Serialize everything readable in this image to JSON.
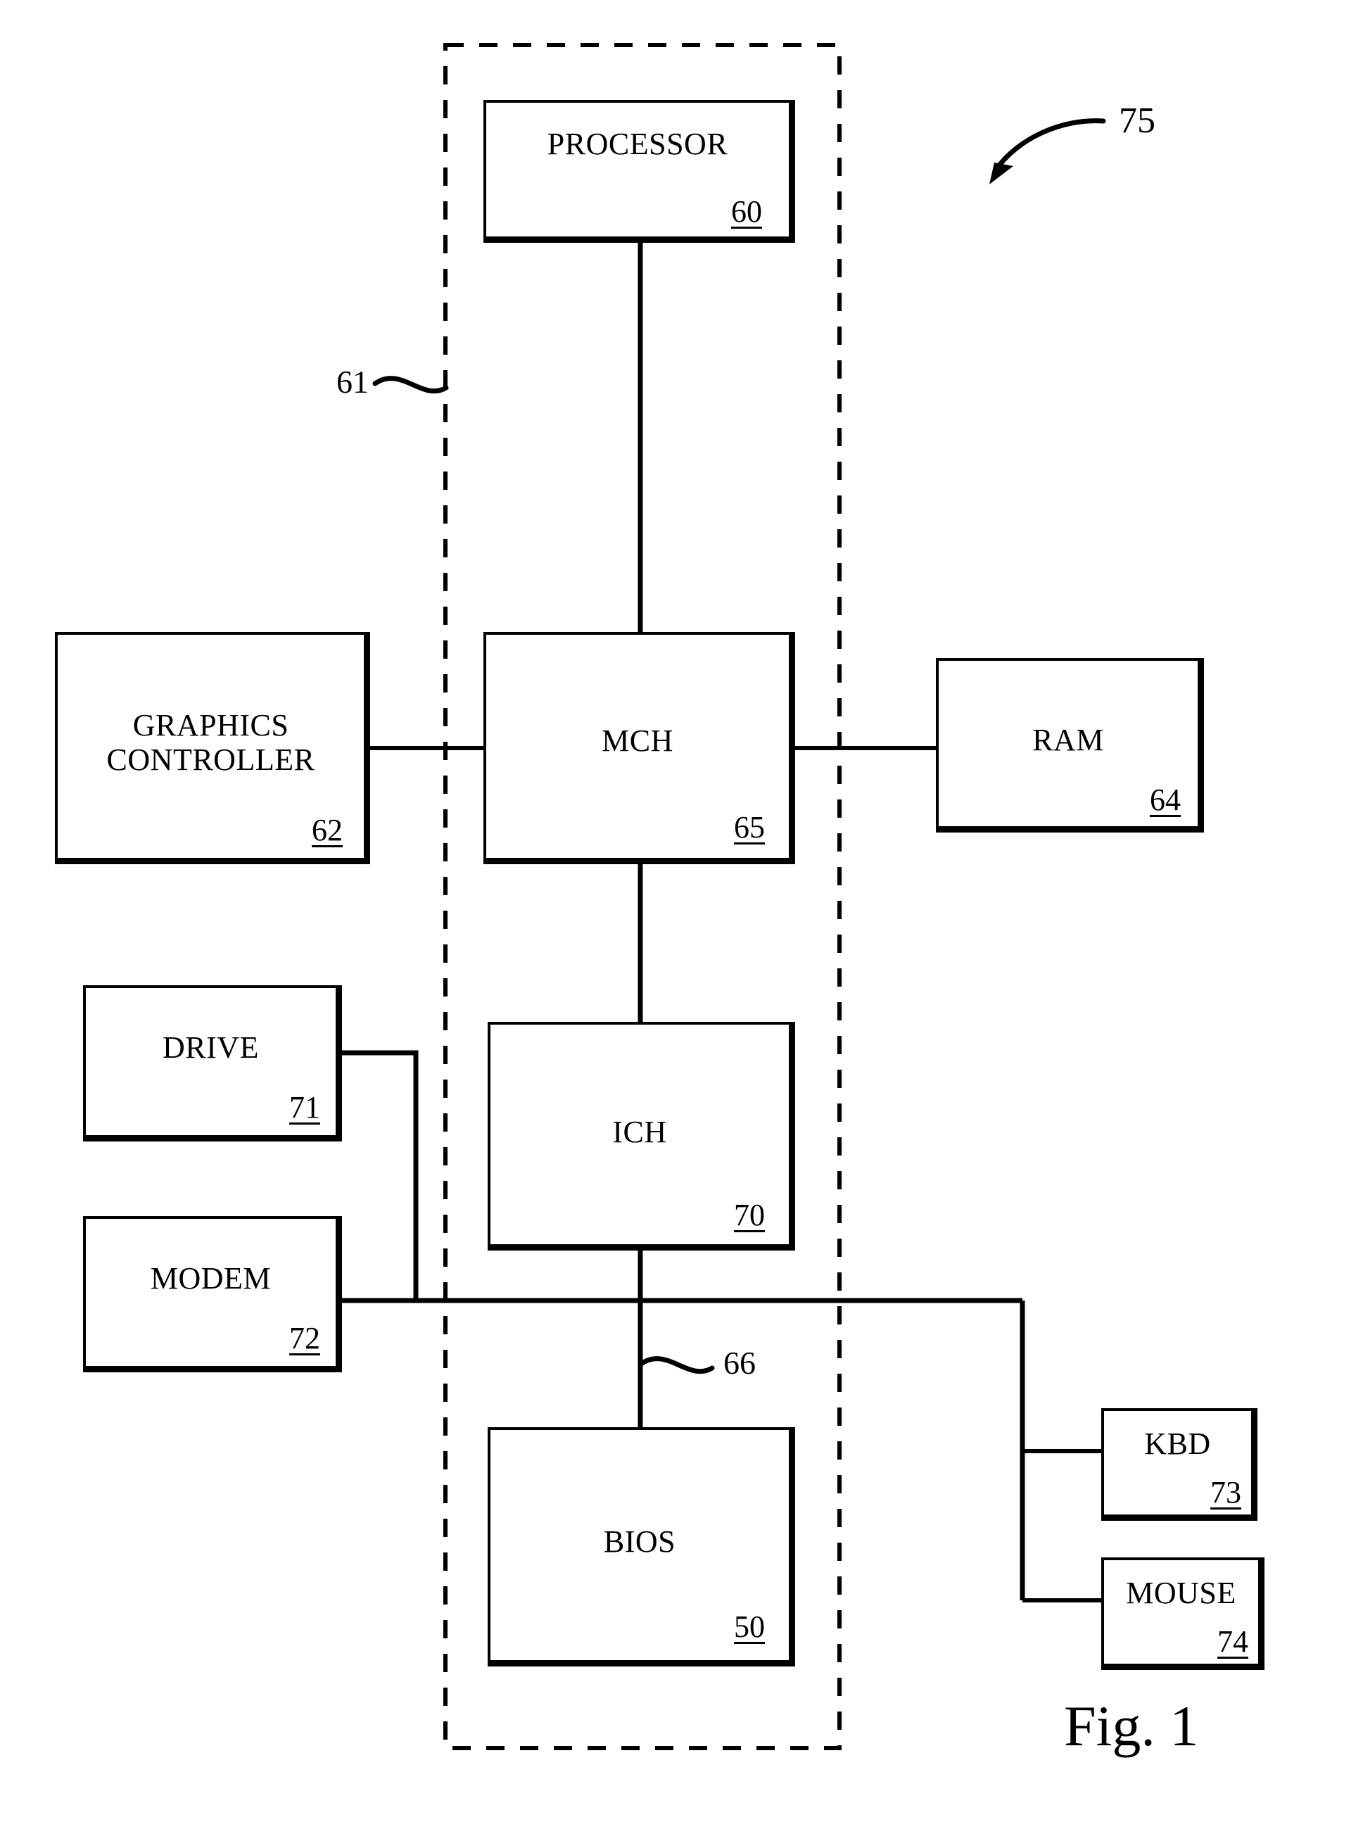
{
  "figure": {
    "caption": "Fig. 1",
    "system_callout": "75",
    "chipset_callout": "61",
    "bus_callout": "66"
  },
  "nodes": {
    "processor": {
      "label": "PROCESSOR",
      "ref": "60"
    },
    "mch": {
      "label": "MCH",
      "ref": "65"
    },
    "ich": {
      "label": "ICH",
      "ref": "70"
    },
    "bios": {
      "label": "BIOS",
      "ref": "50"
    },
    "graphics": {
      "label": "GRAPHICS\nCONTROLLER",
      "ref": "62"
    },
    "ram": {
      "label": "RAM",
      "ref": "64"
    },
    "drive": {
      "label": "DRIVE",
      "ref": "71"
    },
    "modem": {
      "label": "MODEM",
      "ref": "72"
    },
    "kbd": {
      "label": "KBD",
      "ref": "73"
    },
    "mouse": {
      "label": "MOUSE",
      "ref": "74"
    }
  },
  "style": {
    "ink": "#000000",
    "paper": "#ffffff"
  }
}
